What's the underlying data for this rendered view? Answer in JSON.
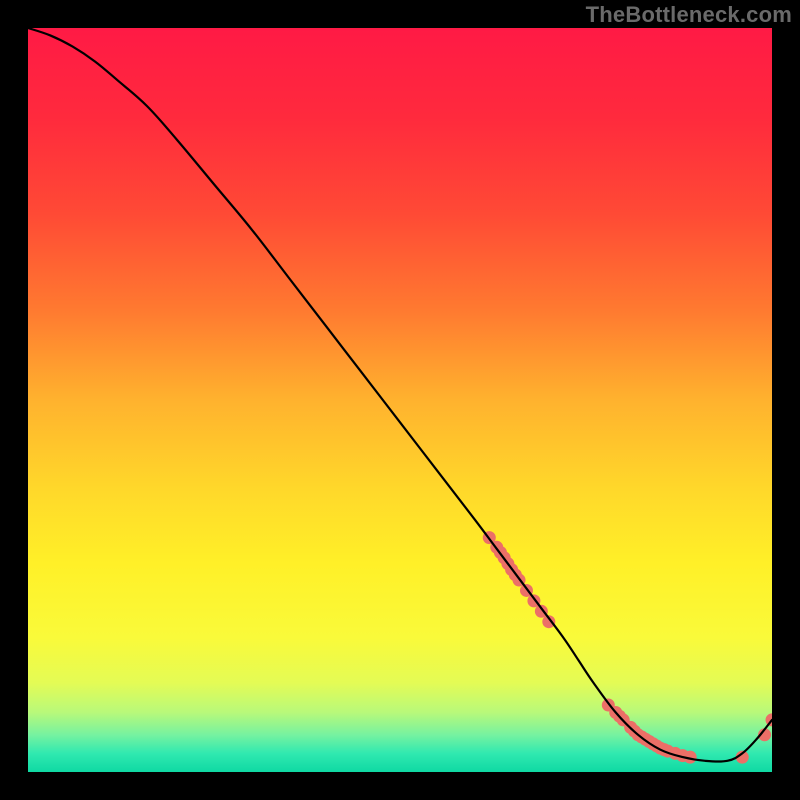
{
  "watermark": "TheBottleneck.com",
  "chart_data": {
    "type": "line",
    "title": "",
    "xlabel": "",
    "ylabel": "",
    "xlim": [
      0,
      100
    ],
    "ylim": [
      0,
      100
    ],
    "gradient_stops": [
      {
        "offset": 0.0,
        "color": "#ff1a45"
      },
      {
        "offset": 0.12,
        "color": "#ff2a3d"
      },
      {
        "offset": 0.25,
        "color": "#ff4a35"
      },
      {
        "offset": 0.38,
        "color": "#ff7a30"
      },
      {
        "offset": 0.5,
        "color": "#ffb22e"
      },
      {
        "offset": 0.62,
        "color": "#ffd82a"
      },
      {
        "offset": 0.72,
        "color": "#fff028"
      },
      {
        "offset": 0.82,
        "color": "#f9fa3a"
      },
      {
        "offset": 0.88,
        "color": "#e4fb55"
      },
      {
        "offset": 0.92,
        "color": "#b8f97a"
      },
      {
        "offset": 0.95,
        "color": "#76f2a0"
      },
      {
        "offset": 0.975,
        "color": "#30e9b0"
      },
      {
        "offset": 1.0,
        "color": "#0fd9a3"
      }
    ],
    "series": [
      {
        "name": "curve",
        "type": "line",
        "x": [
          0,
          3,
          6,
          9,
          12,
          16,
          20,
          25,
          30,
          35,
          40,
          45,
          50,
          55,
          60,
          63,
          66,
          69,
          72,
          74,
          76,
          79,
          82,
          85,
          88,
          91,
          94,
          96,
          98,
          100
        ],
        "y": [
          100,
          99,
          97.5,
          95.5,
          93,
          89.5,
          85,
          79,
          73,
          66.5,
          60,
          53.5,
          47,
          40.5,
          34,
          30,
          26,
          22,
          18,
          15,
          12,
          8,
          5,
          3,
          2,
          1.5,
          1.5,
          2.5,
          4.5,
          7
        ]
      },
      {
        "name": "upper-cluster",
        "type": "scatter",
        "color": "#ec6f67",
        "x": [
          62,
          63,
          63.5,
          64,
          64.5,
          65,
          65.5,
          66,
          67,
          68,
          69,
          70
        ],
        "y": [
          31.5,
          30.2,
          29.5,
          28.8,
          28.0,
          27.2,
          26.5,
          25.8,
          24.4,
          23.0,
          21.6,
          20.2
        ]
      },
      {
        "name": "lower-cluster",
        "type": "scatter",
        "color": "#ec6f67",
        "x": [
          78,
          79,
          79.5,
          80,
          81,
          81.5,
          82,
          82.5,
          83,
          83.5,
          84,
          84.5,
          85,
          85.5,
          86,
          87,
          88,
          89,
          96,
          99,
          100
        ],
        "y": [
          9,
          8,
          7.5,
          7,
          6,
          5.5,
          5,
          4.7,
          4.4,
          4.1,
          3.8,
          3.5,
          3.2,
          3.0,
          2.8,
          2.5,
          2.2,
          2.0,
          2.0,
          5.0,
          7.0
        ]
      }
    ]
  }
}
